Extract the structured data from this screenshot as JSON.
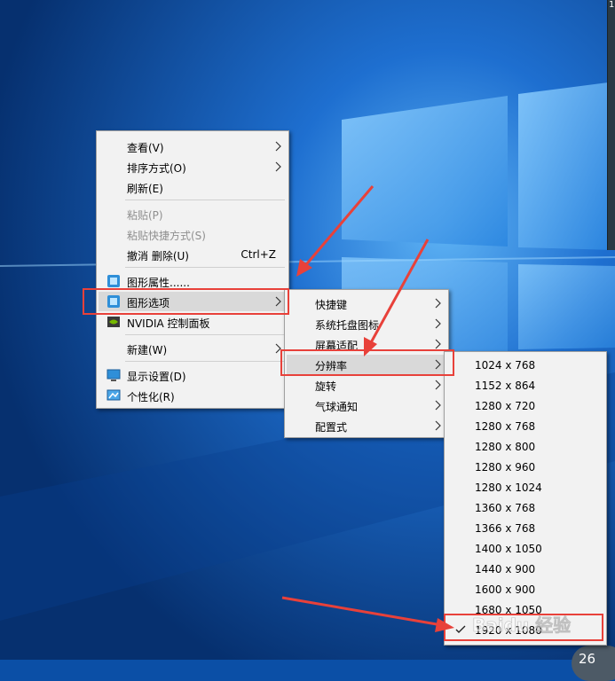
{
  "desktop_menu": {
    "items": [
      {
        "label": "查看(V)"
      },
      {
        "label": "排序方式(O)"
      },
      {
        "label": "刷新(E)"
      },
      {
        "label": "粘贴(P)"
      },
      {
        "label": "粘贴快捷方式(S)"
      },
      {
        "label": "撤消 删除(U)",
        "shortcut": "Ctrl+Z"
      },
      {
        "label": "图形属性......"
      },
      {
        "label": "图形选项"
      },
      {
        "label": "NVIDIA 控制面板"
      },
      {
        "label": "新建(W)"
      },
      {
        "label": "显示设置(D)"
      },
      {
        "label": "个性化(R)"
      }
    ]
  },
  "graphics_options_menu": {
    "items": [
      {
        "label": "快捷键"
      },
      {
        "label": "系统托盘图标"
      },
      {
        "label": "屏幕适配"
      },
      {
        "label": "分辨率"
      },
      {
        "label": "旋转"
      },
      {
        "label": "气球通知"
      },
      {
        "label": "配置式"
      }
    ]
  },
  "resolution_menu": {
    "items": [
      {
        "label": "1024 x 768"
      },
      {
        "label": "1152 x 864"
      },
      {
        "label": "1280 x 720"
      },
      {
        "label": "1280 x 768"
      },
      {
        "label": "1280 x 800"
      },
      {
        "label": "1280 x 960"
      },
      {
        "label": "1280 x 1024"
      },
      {
        "label": "1360 x 768"
      },
      {
        "label": "1366 x 768"
      },
      {
        "label": "1400 x 1050"
      },
      {
        "label": "1440 x 900"
      },
      {
        "label": "1600 x 900"
      },
      {
        "label": "1680 x 1050"
      },
      {
        "label": "1920 x 1080",
        "checked": true
      }
    ]
  },
  "taskbar_badge": "26",
  "corner_window_text": "1",
  "watermark": "Baidu 经验",
  "colors": {
    "annotation_red": "#e8413a",
    "menu_bg": "#f2f2f2",
    "highlight": "#d9d9d9"
  }
}
